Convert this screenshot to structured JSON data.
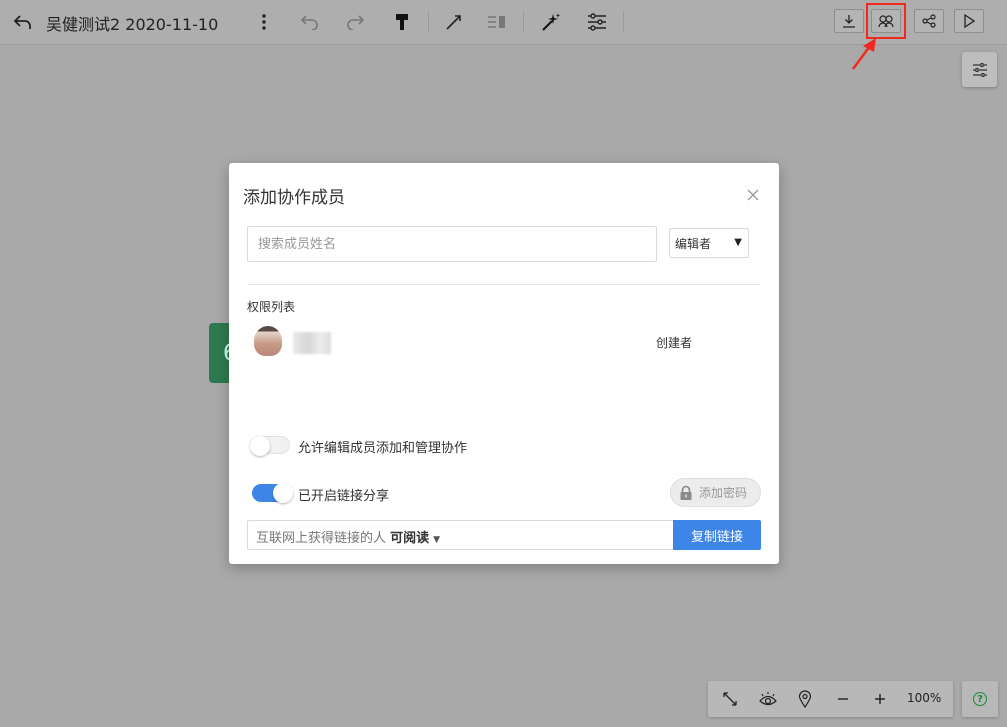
{
  "header": {
    "title": "吴健测试2 2020-11-10"
  },
  "icons": {
    "back": "back-arrow-icon",
    "more": "more-vertical-icon",
    "undo": "undo-icon",
    "redo": "redo-icon",
    "format_painter": "format-painter-icon",
    "connect": "connect-line-icon",
    "summary": "summary-icon",
    "magic": "magic-wand-icon",
    "structure": "structure-icon",
    "download": "download-icon",
    "collaborate": "collaborate-icon",
    "share": "share-icon",
    "play": "play-icon",
    "settings": "settings-sliders-icon"
  },
  "background": {
    "node_text": "6"
  },
  "dialog": {
    "title": "添加协作成员",
    "search_placeholder": "搜索成员姓名",
    "role_value": "编辑者",
    "permission_list_label": "权限列表",
    "members": [
      {
        "role": "创建者"
      }
    ],
    "allow_edit_manage_label": "允许编辑成员添加和管理协作",
    "link_share_label": "已开启链接分享",
    "add_password_label": "添加密码",
    "link_text": "互联网上获得链接的人",
    "link_permission": "可阅读",
    "copy_link_label": "复制链接"
  },
  "zoom": {
    "value": "100%"
  },
  "help": {
    "label": "?"
  },
  "colors": {
    "primary": "#3d86e8",
    "highlight": "#f0281e",
    "node_green": "#2e7a50"
  }
}
